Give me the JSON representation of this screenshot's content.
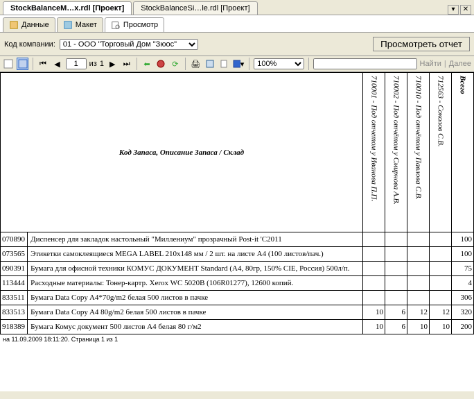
{
  "tabs": [
    {
      "label": "StockBalanceM…x.rdl [Проект]",
      "active": true
    },
    {
      "label": "StockBalanceSi…le.rdl [Проект]",
      "active": false
    }
  ],
  "innertabs": {
    "data": "Данные",
    "layout": "Макет",
    "preview": "Просмотр"
  },
  "filter": {
    "label": "Код компании:",
    "value": "01 - ООО \"Торговый Дом \"Зюос\"",
    "viewbtn": "Просмотреть отчет"
  },
  "toolbar": {
    "page": "1",
    "of": "из",
    "totalpages": "1",
    "zoom": "100%",
    "find": "Найти",
    "next": "Далее"
  },
  "report": {
    "rowhdr": "Код Запаса, Описание Запаса / Склад",
    "cols": [
      "710001 - Под отчетом у Иванова П.П.",
      "710002 - Под отчётом у Смирнова А.В.",
      "710010 - Под отчётом у Павлова С.В.",
      "712563 - Соколов С.В."
    ],
    "totalcol": "Всего",
    "rows": [
      {
        "code": "070890",
        "desc": "Диспенсер для закладок настольный \"Миллениум\" прозрачный Post-it 'C2011",
        "v": [
          "",
          "",
          "",
          ""
        ],
        "t": "100"
      },
      {
        "code": "073565",
        "desc": "Этикетки самоклеящиеся MEGA LABEL 210х148 мм / 2 шт. на листе А4 (100 листов/пач.)",
        "v": [
          "",
          "",
          "",
          ""
        ],
        "t": "100"
      },
      {
        "code": "090391",
        "desc": "Бумага для офисной техники КОМУС ДОКУМЕНТ Standard (A4, 80гр, 150% CIE, Россия) 500л/п.",
        "v": [
          "",
          "",
          "",
          ""
        ],
        "t": "75"
      },
      {
        "code": "113444",
        "desc": "Расходные материалы: Тонер-картр. Xerox WC 5020B (106R01277), 12600 копий.",
        "v": [
          "",
          "",
          "",
          ""
        ],
        "t": "4"
      },
      {
        "code": "833511",
        "desc": "Бумага Data Copy A4*70g/m2 белая 500 листов в пачке",
        "v": [
          "",
          "",
          "",
          ""
        ],
        "t": "306"
      },
      {
        "code": "833513",
        "desc": "Бумага Data Copy A4 80g/m2 белая 500 листов в пачке",
        "v": [
          "10",
          "6",
          "12",
          "12"
        ],
        "t": "320"
      },
      {
        "code": "918389",
        "desc": "Бумага Комус документ 500 листов А4 белая 80 г/м2",
        "v": [
          "10",
          "6",
          "10",
          "10"
        ],
        "t": "200"
      }
    ],
    "footer": "на 11.09.2009 18:11:20. Страница 1 из 1"
  }
}
